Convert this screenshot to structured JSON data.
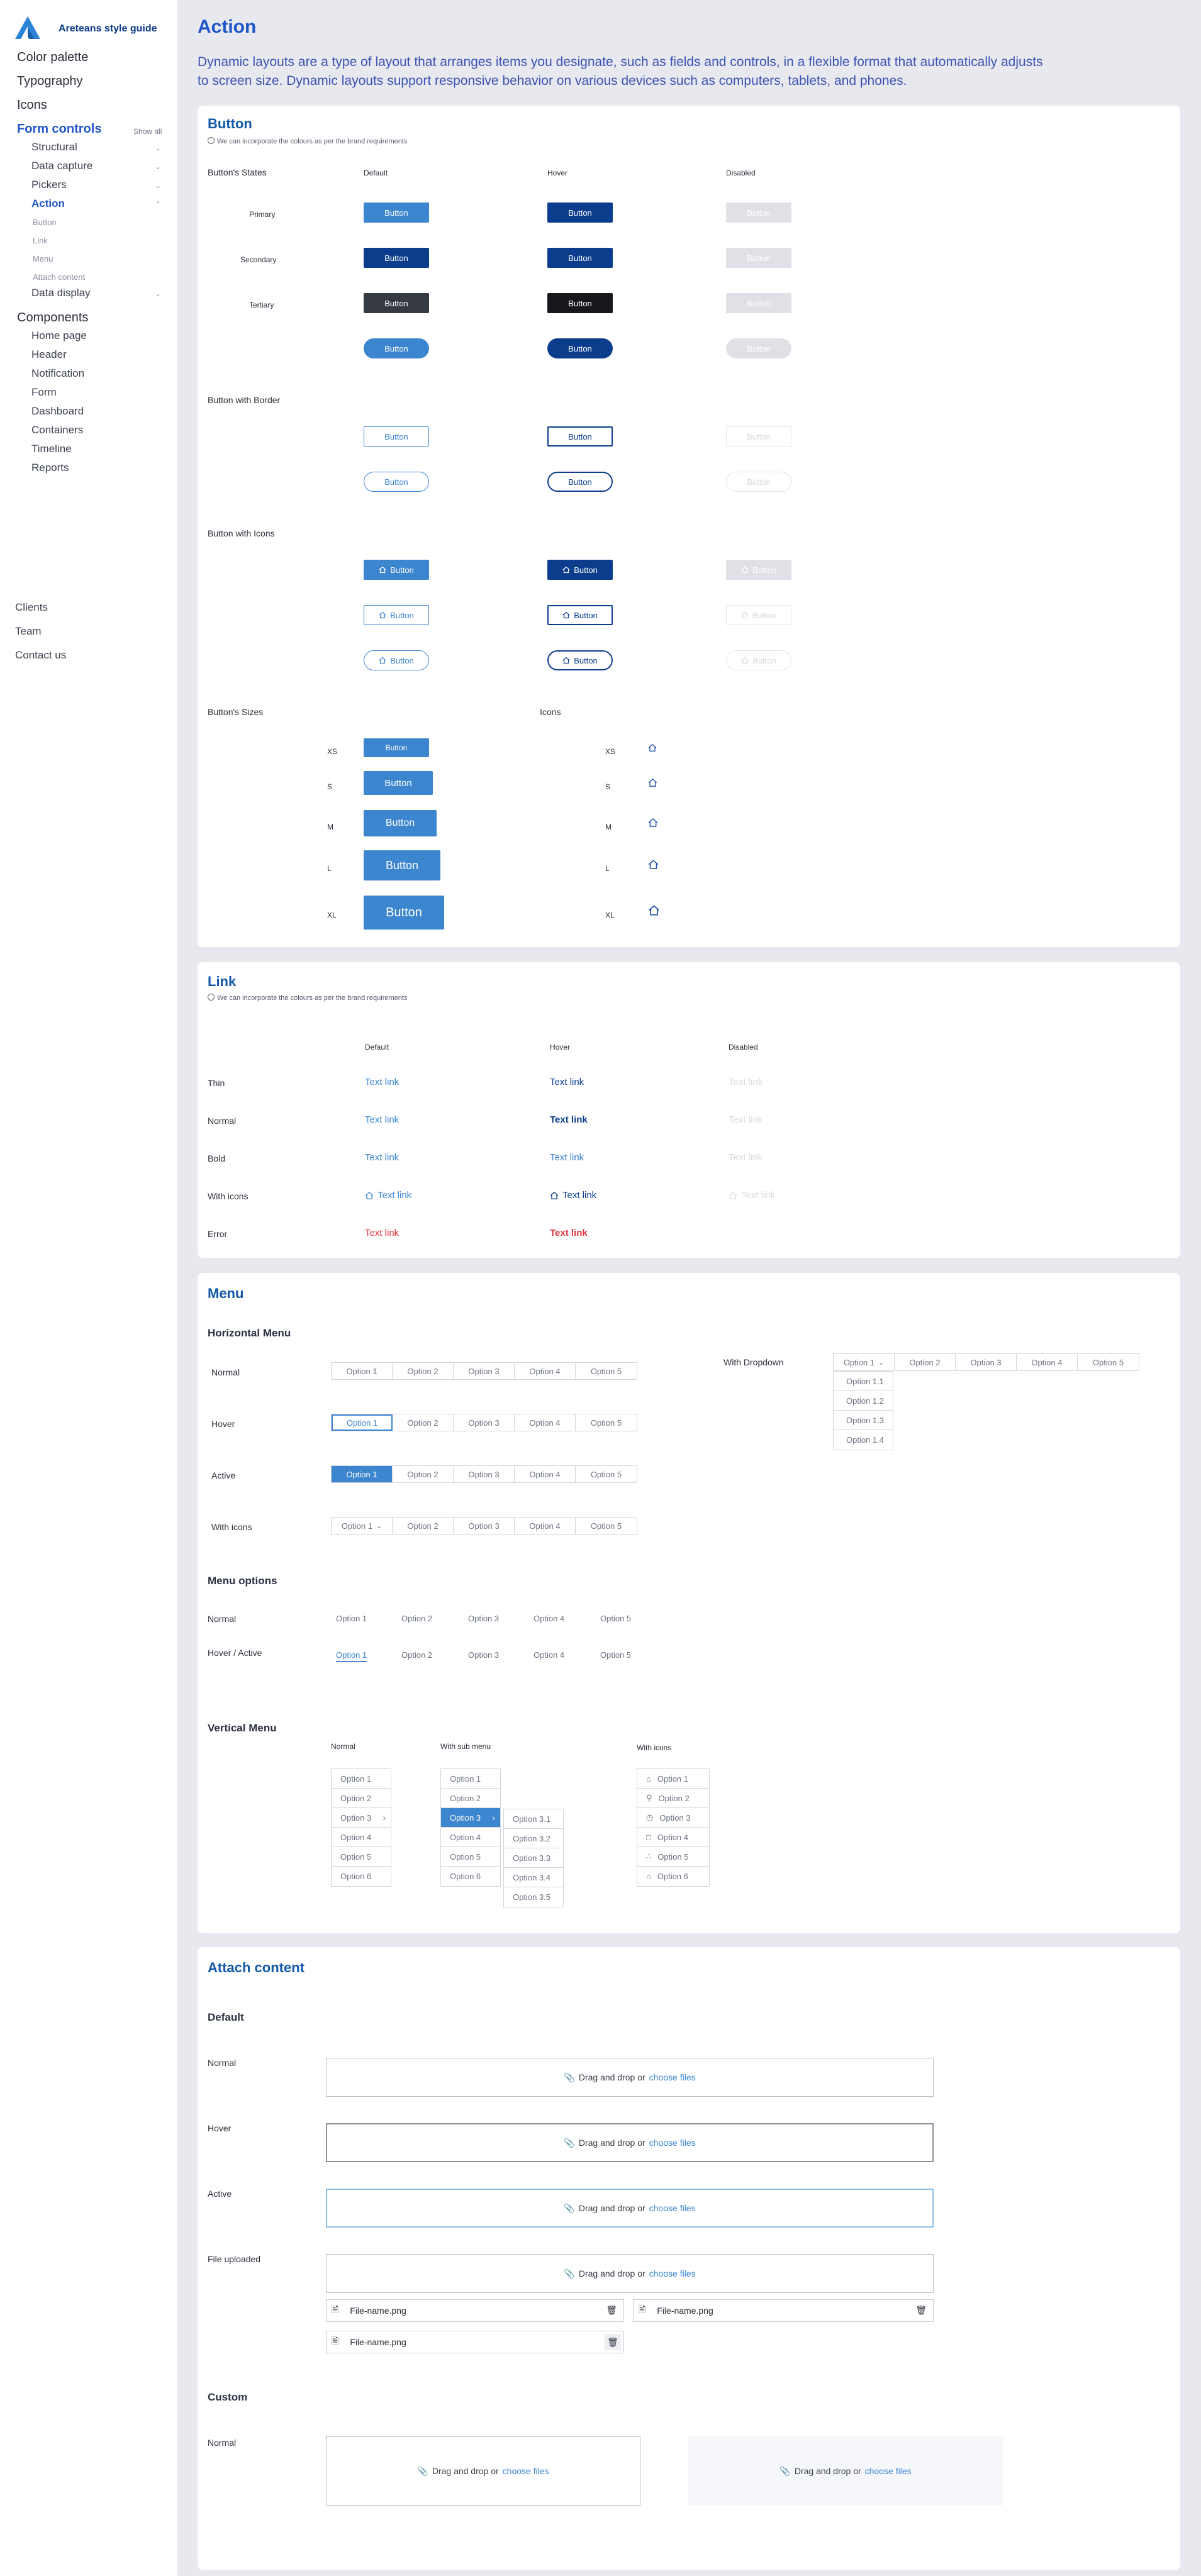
{
  "brand": {
    "name": "Areteans style guide"
  },
  "sidebar": {
    "top": [
      "Color palette",
      "Typography",
      "Icons"
    ],
    "form_controls": "Form controls",
    "show_all": "Show all",
    "form_items": [
      "Structural",
      "Data capture",
      "Pickers",
      "Action",
      "Data display"
    ],
    "action_items": [
      "Button",
      "Link",
      "Menu",
      "Attach content"
    ],
    "components": "Components",
    "component_items": [
      "Home page",
      "Header",
      "Notification",
      "Form",
      "Dashboard",
      "Containers",
      "Timeline",
      "Reports"
    ],
    "bottom": [
      "Clients",
      "Team",
      "Contact us"
    ]
  },
  "page": {
    "title": "Action",
    "intro": "Dynamic layouts are a type of layout that arranges items you designate, such as fields and controls, in a flexible format that automatically adjusts to screen size. Dynamic layouts support responsive behavior on various devices such as computers, tablets, and phones."
  },
  "button_section": {
    "title": "Button",
    "note": "We can incorporate the colours as per the brand requirements",
    "states_label": "Button's States",
    "columns": [
      "Default",
      "Hover",
      "Disabled"
    ],
    "rows": [
      "Primary",
      "Secondary",
      "Tertiary"
    ],
    "button_label": "Button",
    "border_label": "Button with Border",
    "icons_label": "Button with Icons",
    "sizes_label": "Button's Sizes",
    "icons_col_label": "Icons",
    "sizes": [
      "XS",
      "S",
      "M",
      "L",
      "XL"
    ]
  },
  "link_section": {
    "title": "Link",
    "note": "We can incorporate the colours as per the brand requirements",
    "columns": [
      "Default",
      "Hover",
      "Disabled"
    ],
    "rows": [
      "Thin",
      "Normal",
      "Bold",
      "With icons",
      "Error"
    ],
    "link_text": "Text link"
  },
  "menu_section": {
    "title": "Menu",
    "horizontal_label": "Horizontal Menu",
    "h_rows": [
      "Normal",
      "Hover",
      "Active",
      "With icons"
    ],
    "with_dropdown": "With Dropdown",
    "options": [
      "Option 1",
      "Option 2",
      "Option 3",
      "Option 4",
      "Option 5"
    ],
    "dropdown_options": [
      "Option 1.1",
      "Option 1.2",
      "Option 1.3",
      "Option 1.4"
    ],
    "menu_options_label": "Menu options",
    "mo_rows": [
      "Normal",
      "Hover / Active"
    ],
    "vertical_label": "Vertical Menu",
    "v_cols": [
      "Normal",
      "With sub menu",
      "With icons"
    ],
    "v_options": [
      "Option 1",
      "Option 2",
      "Option 3",
      "Option 4",
      "Option 5",
      "Option 6"
    ],
    "sub_options": [
      "Option 3.1",
      "Option 3.2",
      "Option 3.3",
      "Option 3.4",
      "Option 3.5"
    ]
  },
  "attach_section": {
    "title": "Attach content",
    "default_label": "Default",
    "rows": [
      "Normal",
      "Hover",
      "Active",
      "File uploaded"
    ],
    "drop_text": "Drag and drop or",
    "choose_text": "choose files",
    "file_name": "File-name.png",
    "custom_label": "Custom",
    "custom_rows": [
      "Normal"
    ]
  },
  "colors": {
    "brand_blue": "#1e55c8",
    "primary": "#3c85cf",
    "hover": "#0b3d8c",
    "error": "#e0353f"
  }
}
